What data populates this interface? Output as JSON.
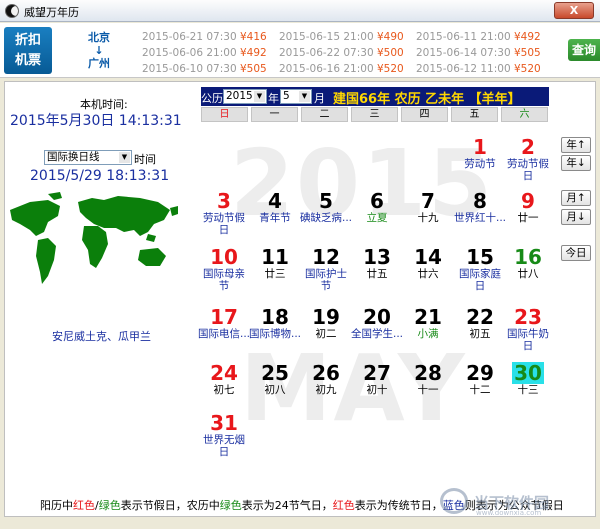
{
  "window": {
    "title": "威望万年历",
    "close_label": "X"
  },
  "ad": {
    "badge_line1": "折扣",
    "badge_line2": "机票",
    "route_from": "北京",
    "route_arrow": "↓",
    "route_to": "广州",
    "flights": [
      [
        {
          "time": "2015-06-21 07:30",
          "price": "¥416"
        },
        {
          "time": "2015-06-15 21:00",
          "price": "¥490"
        },
        {
          "time": "2015-06-11 21:00",
          "price": "¥492"
        }
      ],
      [
        {
          "time": "2015-06-06 21:00",
          "price": "¥492"
        },
        {
          "time": "2015-06-22 07:30",
          "price": "¥500"
        },
        {
          "time": "2015-06-14 07:30",
          "price": "¥505"
        }
      ],
      [
        {
          "time": "2015-06-10 07:30",
          "price": "¥505"
        },
        {
          "time": "2015-06-16 21:00",
          "price": "¥520"
        },
        {
          "time": "2015-06-12 11:00",
          "price": "¥520"
        }
      ]
    ],
    "search_label": "查询"
  },
  "left": {
    "local_label": "本机时间:",
    "local_time": "2015年5月30日  14:13:31",
    "tz_select": "国际换日线",
    "tz_label": "时间",
    "tz_time": "2015/5/29 18:13:31",
    "location": "安尼威土克、瓜甲兰"
  },
  "calendar": {
    "prefix": "公历",
    "year_value": "2015",
    "year_suffix": "年",
    "month_value": "5",
    "month_suffix": "月",
    "lunar_header": "建国66年  农历  乙未年  【羊年】",
    "weekdays": [
      "日",
      "一",
      "二",
      "三",
      "四",
      "五",
      "六"
    ],
    "watermark_year": "2015",
    "watermark_month": "MAY",
    "days": [
      {
        "num": "1",
        "sub": "劳动节",
        "num_color": "red",
        "sub_color": "blue"
      },
      {
        "num": "2",
        "sub": "劳动节假日",
        "num_color": "red",
        "sub_color": "blue"
      },
      {
        "num": "3",
        "sub": "劳动节假日",
        "num_color": "red",
        "sub_color": "blue"
      },
      {
        "num": "4",
        "sub": "青年节",
        "num_color": "black",
        "sub_color": "blue"
      },
      {
        "num": "5",
        "sub": "碘缺乏病...",
        "num_color": "black",
        "sub_color": "blue"
      },
      {
        "num": "6",
        "sub": "立夏",
        "num_color": "black",
        "sub_color": "green"
      },
      {
        "num": "7",
        "sub": "十九",
        "num_color": "black",
        "sub_color": "black"
      },
      {
        "num": "8",
        "sub": "世界红十...",
        "num_color": "black",
        "sub_color": "blue"
      },
      {
        "num": "9",
        "sub": "廿一",
        "num_color": "red",
        "sub_color": "black"
      },
      {
        "num": "10",
        "sub": "国际母亲节",
        "num_color": "red",
        "sub_color": "blue"
      },
      {
        "num": "11",
        "sub": "廿三",
        "num_color": "black",
        "sub_color": "black"
      },
      {
        "num": "12",
        "sub": "国际护士节",
        "num_color": "black",
        "sub_color": "blue"
      },
      {
        "num": "13",
        "sub": "廿五",
        "num_color": "black",
        "sub_color": "black"
      },
      {
        "num": "14",
        "sub": "廿六",
        "num_color": "black",
        "sub_color": "black"
      },
      {
        "num": "15",
        "sub": "国际家庭日",
        "num_color": "black",
        "sub_color": "blue"
      },
      {
        "num": "16",
        "sub": "廿八",
        "num_color": "green",
        "sub_color": "black"
      },
      {
        "num": "17",
        "sub": "国际电信...",
        "num_color": "red",
        "sub_color": "blue"
      },
      {
        "num": "18",
        "sub": "国际博物...",
        "num_color": "black",
        "sub_color": "blue"
      },
      {
        "num": "19",
        "sub": "初二",
        "num_color": "black",
        "sub_color": "black"
      },
      {
        "num": "20",
        "sub": "全国学生...",
        "num_color": "black",
        "sub_color": "blue"
      },
      {
        "num": "21",
        "sub": "小满",
        "num_color": "black",
        "sub_color": "green"
      },
      {
        "num": "22",
        "sub": "初五",
        "num_color": "black",
        "sub_color": "black"
      },
      {
        "num": "23",
        "sub": "国际牛奶日",
        "num_color": "red",
        "sub_color": "blue"
      },
      {
        "num": "24",
        "sub": "初七",
        "num_color": "red",
        "sub_color": "black"
      },
      {
        "num": "25",
        "sub": "初八",
        "num_color": "black",
        "sub_color": "black"
      },
      {
        "num": "26",
        "sub": "初九",
        "num_color": "black",
        "sub_color": "black"
      },
      {
        "num": "27",
        "sub": "初十",
        "num_color": "black",
        "sub_color": "black"
      },
      {
        "num": "28",
        "sub": "十一",
        "num_color": "black",
        "sub_color": "black"
      },
      {
        "num": "29",
        "sub": "十二",
        "num_color": "black",
        "sub_color": "black"
      },
      {
        "num": "30",
        "sub": "十三",
        "num_color": "green",
        "sub_color": "black",
        "today": true
      },
      {
        "num": "31",
        "sub": "世界无烟日",
        "num_color": "red",
        "sub_color": "blue"
      }
    ],
    "first_weekday": 5
  },
  "nav": {
    "year_up": "年↑",
    "year_down": "年↓",
    "month_up": "月↑",
    "month_down": "月↓",
    "today": "今日"
  },
  "footer": {
    "p1": "阳历中",
    "red1": "红色",
    "slash": "/",
    "green1": "绿色",
    "p2": "表示节假日，农历中",
    "green2": "绿色",
    "p3": "表示为24节气日，",
    "red2": "红色",
    "p4": "表示为传统节日，",
    "blue1": "蓝色",
    "p5": "则表示为公众节假日"
  },
  "watermark": {
    "name": "当下软件园",
    "url": "www.downxia.com"
  }
}
